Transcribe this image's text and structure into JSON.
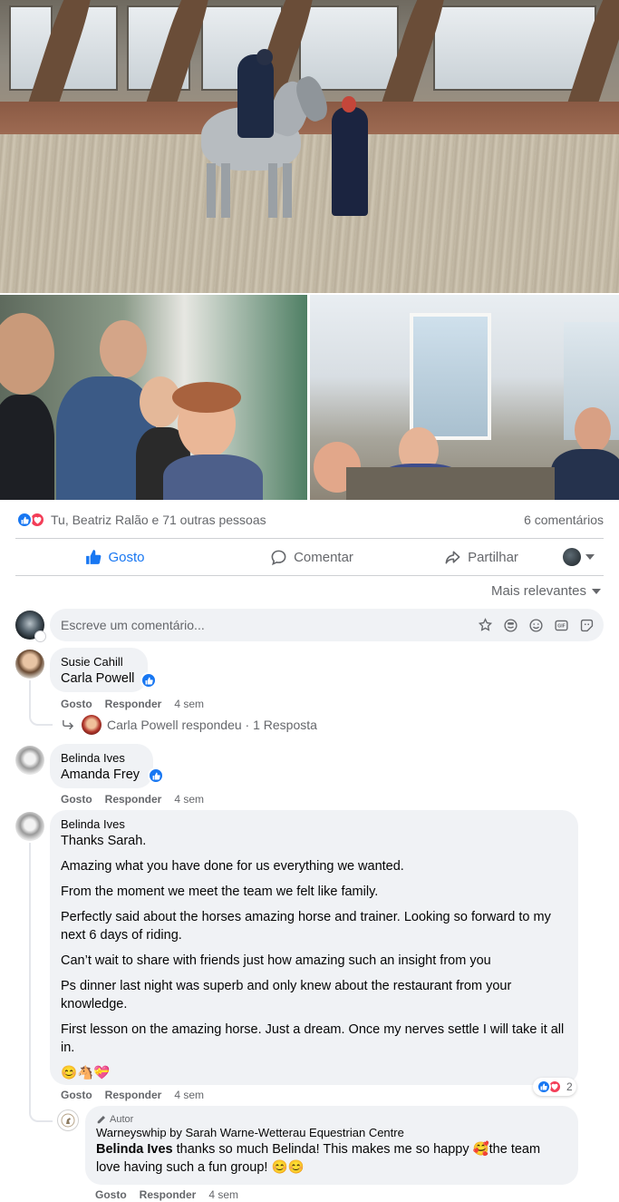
{
  "post": {
    "reaction_summary": "Tu, Beatriz Ralão e 71 outras pessoas",
    "comments_count": "6 comentários"
  },
  "actions": {
    "like": "Gosto",
    "comment": "Comentar",
    "share": "Partilhar"
  },
  "sort": {
    "label": "Mais relevantes"
  },
  "composer": {
    "placeholder": "Escreve um comentário..."
  },
  "comments": [
    {
      "author": "Susie Cahill",
      "text": "Carla Powell",
      "actions": [
        "Gosto",
        "Responder"
      ],
      "time": "4 sem",
      "replies_summary": "Carla Powell respondeu · 1 Resposta"
    },
    {
      "author": "Belinda Ives",
      "text": "Amanda Frey",
      "actions": [
        "Gosto",
        "Responder"
      ],
      "time": "4 sem"
    },
    {
      "author": "Belinda Ives",
      "paragraphs": [
        "Thanks Sarah.",
        "Amazing what you have done for us everything we wanted.",
        "From the moment we meet the team we felt like family.",
        "Perfectly said about the horses amazing horse and trainer. Looking so forward to my next 6 days of riding.",
        "Can’t wait to share with friends just how amazing such an insight from you",
        "Ps dinner last night was superb and only knew about the restaurant from your knowledge.",
        "First lesson on the amazing horse. Just a dream. Once my nerves settle I will take it all in.",
        "😊🐴💝"
      ],
      "actions": [
        "Gosto",
        "Responder"
      ],
      "time": "4 sem",
      "reaction_count": "2"
    }
  ],
  "reply": {
    "badge": "Autor",
    "author": "Warneyswhip by Sarah Warne-Wetterau Equestrian Centre",
    "mention": "Belinda Ives",
    "text": " thanks so much Belinda! This makes me so happy 🥰the team love having such a fun group! 😊😊",
    "actions": [
      "Gosto",
      "Responder"
    ],
    "time": "4 sem"
  },
  "colors": {
    "accent": "#1877f2",
    "love": "#f33e58",
    "secondary_text": "#65676b",
    "bubble": "#f0f2f5"
  }
}
